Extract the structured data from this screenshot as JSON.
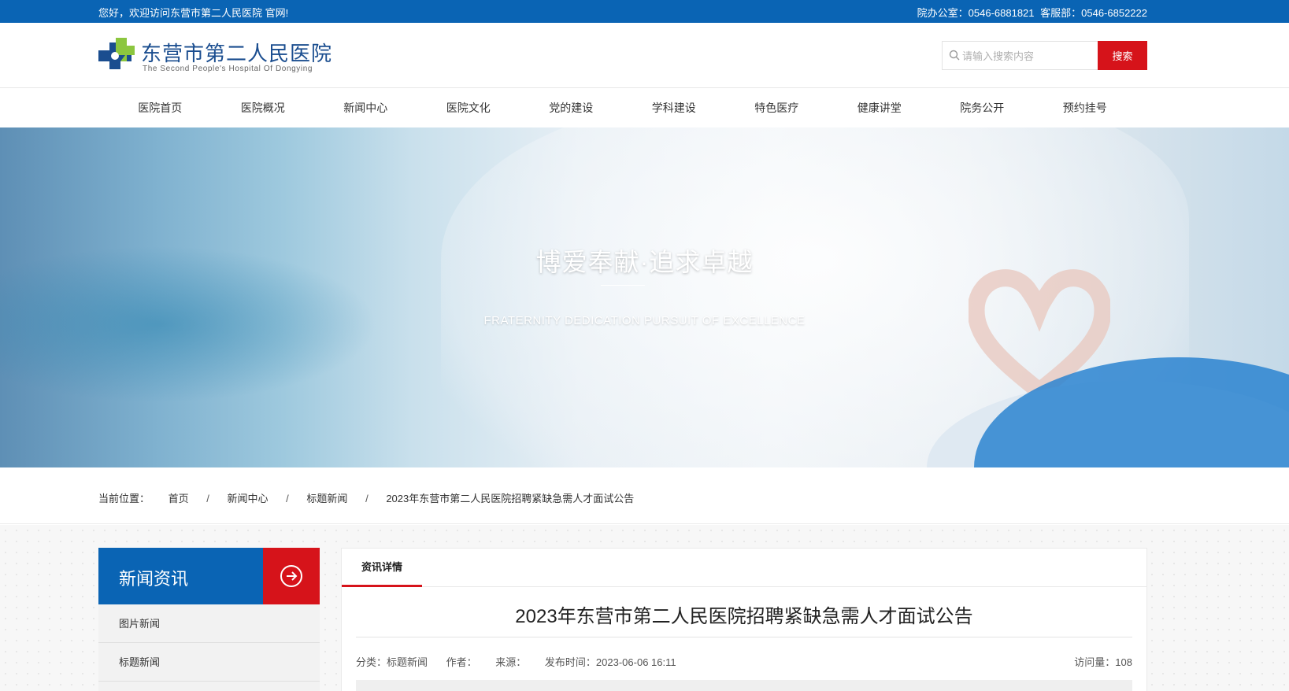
{
  "topbar": {
    "welcome": "您好，欢迎访问东营市第二人民医院 官网!",
    "office": "院办公室：0546-6881821",
    "service": "客服部：0546-6852222"
  },
  "header": {
    "logo_cn": "东营市第二人民医院",
    "logo_en": "The Second People's Hospital Of Dongying",
    "search_placeholder": "请输入搜索内容",
    "search_button": "搜索"
  },
  "nav": [
    "医院首页",
    "医院概况",
    "新闻中心",
    "医院文化",
    "党的建设",
    "学科建设",
    "特色医疗",
    "健康讲堂",
    "院务公开",
    "预约挂号"
  ],
  "banner": {
    "slogan": "博爱奉献·追求卓越",
    "slogan_en": "FRATERNITY DEDICATION PURSUIT OF EXCELLENCE"
  },
  "breadcrumb": {
    "label": "当前位置：",
    "items": [
      "首页",
      "新闻中心",
      "标题新闻",
      "2023年东营市第二人民医院招聘紧缺急需人才面试公告"
    ],
    "separator": "/"
  },
  "sidebar": {
    "title": "新闻资讯",
    "items": [
      "图片新闻",
      "标题新闻"
    ]
  },
  "article": {
    "tab": "资讯详情",
    "title": "2023年东营市第二人民医院招聘紧缺急需人才面试公告",
    "category": "分类：标题新闻",
    "author": "作者：",
    "source": "来源：",
    "published": "发布时间：2023-06-06 16:11",
    "views": "访问量：108"
  },
  "colors": {
    "brand_blue": "#0a64b4",
    "accent_red": "#d6131a"
  }
}
